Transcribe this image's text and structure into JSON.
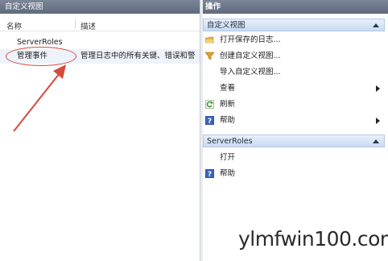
{
  "left": {
    "title": "自定义视图",
    "columns": {
      "name": "名称",
      "description": "描述"
    },
    "rows": [
      {
        "name": "ServerRoles",
        "description": ""
      },
      {
        "name": "管理事件",
        "description": "管理日志中的所有关键、错误和警"
      }
    ]
  },
  "right": {
    "title": "操作",
    "sections": [
      {
        "header": "自定义视图",
        "items": [
          {
            "label": "打开保存的日志...",
            "icon": "folder-open-icon"
          },
          {
            "label": "创建自定义视图...",
            "icon": "filter-icon"
          },
          {
            "label": "导入自定义视图...",
            "icon": ""
          },
          {
            "label": "查看",
            "icon": "",
            "submenu": true
          },
          {
            "label": "刷新",
            "icon": "refresh-icon"
          },
          {
            "label": "帮助",
            "icon": "help-icon",
            "submenu": true
          }
        ]
      },
      {
        "header": "ServerRoles",
        "items": [
          {
            "label": "打开",
            "icon": ""
          },
          {
            "label": "帮助",
            "icon": "help-icon"
          }
        ]
      }
    ]
  },
  "annotation": {
    "color": "#d44a3c"
  },
  "watermark": "ylmfwin100.com"
}
